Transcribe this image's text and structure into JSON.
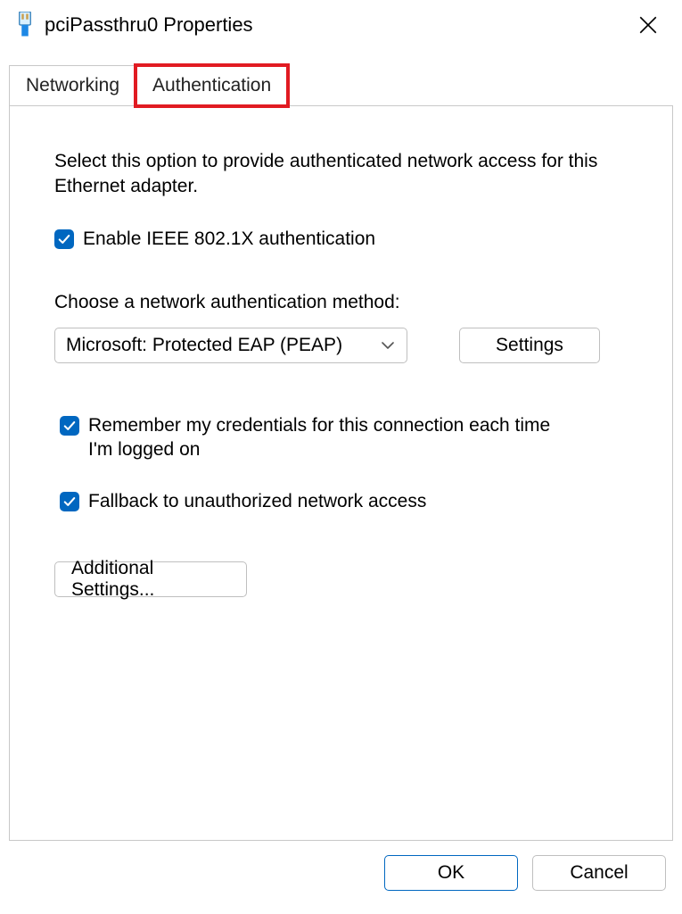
{
  "titlebar": {
    "title": "pciPassthru0 Properties"
  },
  "tabs": {
    "networking": "Networking",
    "authentication": "Authentication"
  },
  "page": {
    "description": "Select this option to provide authenticated network access for this Ethernet adapter.",
    "enable_8021x_label": "Enable IEEE 802.1X authentication",
    "enable_8021x_checked": true,
    "choose_method_label": "Choose a network authentication method:",
    "method_selected": "Microsoft: Protected EAP (PEAP)",
    "settings_button": "Settings",
    "remember_label": "Remember my credentials for this connection each time I'm logged on",
    "remember_checked": true,
    "fallback_label": "Fallback to unauthorized network access",
    "fallback_checked": true,
    "additional_settings_button": "Additional Settings..."
  },
  "footer": {
    "ok": "OK",
    "cancel": "Cancel"
  }
}
